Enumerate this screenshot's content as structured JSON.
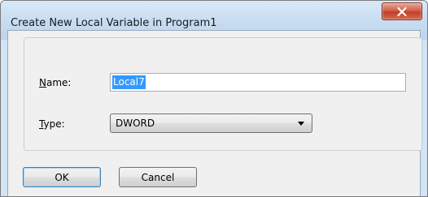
{
  "window": {
    "title": "Create New Local Variable in Program1",
    "close_glyph": "✕"
  },
  "form": {
    "name_label_key": "N",
    "name_label_rest": "ame:",
    "name_value": "Local7",
    "type_label_key": "T",
    "type_label_rest": "ype:",
    "type_value": "DWORD"
  },
  "buttons": {
    "ok_label": "OK",
    "cancel_label": "Cancel"
  },
  "icons": {
    "close": "close-icon",
    "dropdown": "chevron-down-icon"
  },
  "colors": {
    "selection": "#3399ff",
    "close_button": "#c1402a",
    "default_button_border": "#3c7fb1"
  }
}
